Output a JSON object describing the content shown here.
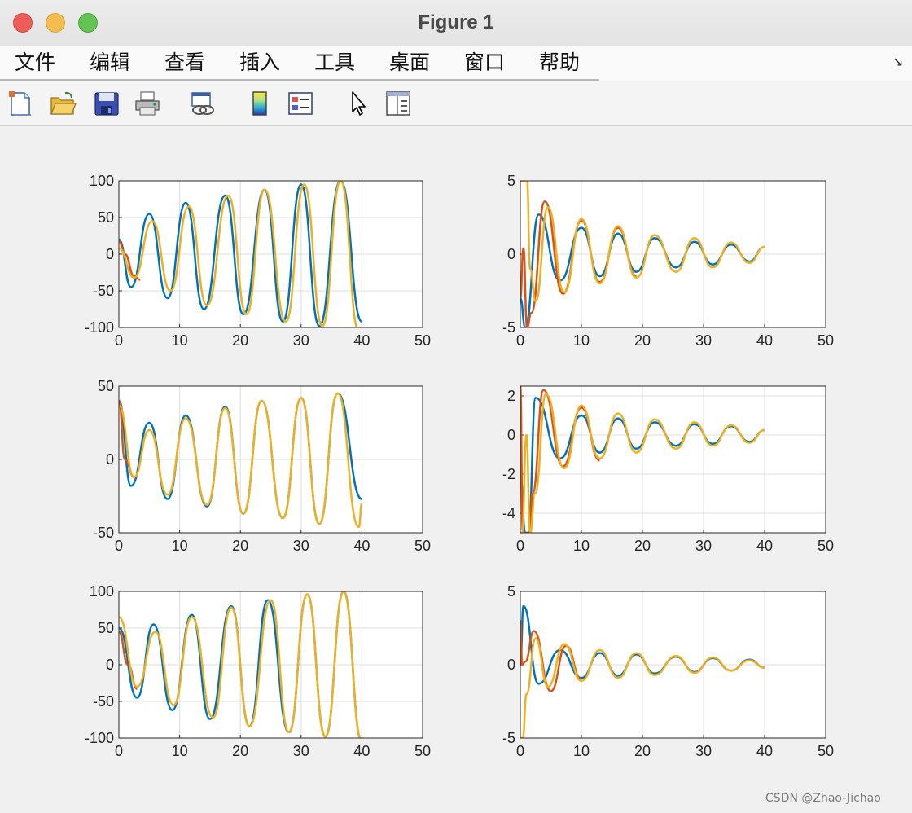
{
  "window": {
    "title": "Figure 1"
  },
  "menu": {
    "items": [
      "文件",
      "编辑",
      "查看",
      "插入",
      "工具",
      "桌面",
      "窗口",
      "帮助"
    ],
    "corner_glyph": "↘"
  },
  "toolbar": {
    "tools": [
      {
        "name": "new-figure-icon"
      },
      {
        "name": "open-file-icon"
      },
      {
        "name": "save-icon"
      },
      {
        "name": "print-icon"
      },
      {
        "name": "link-figure-icon"
      },
      {
        "name": "colorbar-icon"
      },
      {
        "name": "legend-icon"
      },
      {
        "name": "pointer-icon"
      },
      {
        "name": "property-inspector-icon"
      }
    ]
  },
  "colors": {
    "series1": "#0072bd",
    "series2": "#d95319",
    "series3": "#edb120"
  },
  "chart_data": [
    {
      "type": "line",
      "xlim": [
        0,
        50
      ],
      "ylim": [
        -100,
        100
      ],
      "xticks": [
        "0",
        "10",
        "20",
        "30",
        "40",
        "50"
      ],
      "yticks": [
        "100",
        "50",
        "0",
        "-50",
        "-100"
      ],
      "ytick_values": [
        100,
        50,
        0,
        -50,
        -100
      ],
      "grid": true,
      "series": [
        {
          "color": "series1",
          "x": [
            0,
            2,
            5,
            8,
            11,
            14,
            17.5,
            20.5,
            24,
            27,
            30,
            33,
            36.5,
            40
          ],
          "y": [
            20,
            -45,
            55,
            -60,
            70,
            -75,
            80,
            -82,
            88,
            -92,
            95,
            -98,
            100,
            -92
          ]
        },
        {
          "color": "series2",
          "x": [
            0,
            1,
            2.5,
            3.5
          ],
          "y": [
            18,
            0,
            -30,
            -35
          ]
        },
        {
          "color": "series3",
          "x": [
            0,
            2.5,
            5.5,
            8.5,
            11.5,
            14.5,
            18,
            21,
            24,
            27.5,
            30.5,
            33.5,
            36.5,
            39.5
          ],
          "y": [
            8,
            -32,
            45,
            -50,
            65,
            -70,
            80,
            -82,
            88,
            -92,
            95,
            -98,
            100,
            -105
          ]
        }
      ]
    },
    {
      "type": "line",
      "xlim": [
        0,
        50
      ],
      "ylim": [
        -5,
        5
      ],
      "xticks": [
        "0",
        "10",
        "20",
        "30",
        "40",
        "50"
      ],
      "yticks": [
        "5",
        "0",
        "-5"
      ],
      "ytick_values": [
        5,
        0,
        -5
      ],
      "grid": true,
      "series": [
        {
          "color": "series1",
          "x": [
            0,
            0.8,
            3,
            6.5,
            10,
            13,
            16,
            19,
            22,
            25.5,
            28.5,
            31.5,
            34.5,
            37.5,
            40
          ],
          "y": [
            -3,
            -5,
            2.7,
            -1.8,
            1.8,
            -1.5,
            1.4,
            -1.2,
            1.1,
            -0.9,
            0.85,
            -0.7,
            0.65,
            -0.5,
            0.5
          ]
        },
        {
          "color": "series2",
          "x": [
            0,
            0.5,
            1.1,
            1.8,
            4,
            7,
            10,
            13,
            16,
            19
          ],
          "y": [
            -3,
            0.4,
            -5,
            -4,
            3.6,
            -2.7,
            2.3,
            -1.9,
            1.8,
            -1.5
          ]
        },
        {
          "color": "series3",
          "x": [
            0,
            0.5,
            1.1,
            1.6,
            2.5,
            4.5,
            7.2,
            10,
            13,
            16,
            19,
            22,
            25.5,
            28.5,
            31.5,
            34.5,
            37.5,
            40
          ],
          "y": [
            5,
            5,
            5,
            -1,
            -3.2,
            3.2,
            -2.6,
            2.4,
            -2.0,
            1.9,
            -1.6,
            1.3,
            -1.2,
            1.1,
            -0.9,
            0.8,
            -0.6,
            0.5
          ]
        }
      ]
    },
    {
      "type": "line",
      "xlim": [
        0,
        50
      ],
      "ylim": [
        -50,
        50
      ],
      "xticks": [
        "0",
        "10",
        "20",
        "30",
        "40",
        "50"
      ],
      "yticks": [
        "50",
        "0",
        "-50"
      ],
      "ytick_values": [
        50,
        0,
        -50
      ],
      "grid": true,
      "series": [
        {
          "color": "series1",
          "x": [
            0,
            2,
            5,
            8,
            11,
            14.5,
            17.5,
            20.5,
            23.5,
            27,
            30,
            33,
            36,
            40
          ],
          "y": [
            40,
            -18,
            25,
            -27,
            30,
            -32,
            36,
            -37,
            40,
            -40,
            42,
            -44,
            45,
            -27
          ]
        },
        {
          "color": "series2",
          "x": [
            0,
            1,
            2.5
          ],
          "y": [
            40,
            0,
            -12
          ]
        },
        {
          "color": "series3",
          "x": [
            0,
            2.5,
            5,
            8,
            11,
            14.5,
            17.5,
            20.5,
            23.5,
            27,
            30,
            33,
            36,
            39.5,
            40
          ],
          "y": [
            37,
            -12,
            20,
            -24,
            28,
            -31,
            35,
            -37,
            40,
            -40,
            42,
            -44,
            45,
            -46,
            -30
          ]
        }
      ]
    },
    {
      "type": "line",
      "xlim": [
        0,
        50
      ],
      "ylim": [
        -5,
        2.5
      ],
      "xticks": [
        "0",
        "10",
        "20",
        "30",
        "40",
        "50"
      ],
      "yticks": [
        "2",
        "0",
        "-2",
        "-4"
      ],
      "ytick_values": [
        2,
        0,
        -2,
        -4
      ],
      "grid": true,
      "series": [
        {
          "color": "series1",
          "x": [
            0,
            0.8,
            1.3,
            2.5,
            6.5,
            10,
            13,
            16,
            19,
            22,
            25.5,
            28.5,
            31.5,
            34.5,
            37.5,
            40
          ],
          "y": [
            -2,
            -5,
            -5,
            1.9,
            -1.2,
            1.0,
            -0.9,
            0.85,
            -0.7,
            0.65,
            -0.55,
            0.55,
            -0.45,
            0.45,
            -0.35,
            0.25
          ]
        },
        {
          "color": "series2",
          "x": [
            0,
            0.4,
            1.5,
            2,
            3.8,
            7,
            10,
            13
          ],
          "y": [
            2.5,
            -5,
            -5,
            -3,
            2.3,
            -1.6,
            1.4,
            -1.3
          ]
        },
        {
          "color": "series3",
          "x": [
            0,
            0.3,
            1,
            1.6,
            2.4,
            4.2,
            7.2,
            10,
            13,
            16,
            19,
            22,
            25.5,
            28.5,
            31.5,
            34.5,
            37.5,
            40
          ],
          "y": [
            -5,
            -5,
            0,
            -5,
            -3,
            2.1,
            -1.7,
            1.5,
            -1.2,
            1.1,
            -0.9,
            0.8,
            -0.7,
            0.65,
            -0.55,
            0.5,
            -0.4,
            0.25
          ]
        }
      ]
    },
    {
      "type": "line",
      "xlim": [
        0,
        50
      ],
      "ylim": [
        -100,
        100
      ],
      "xticks": [
        "0",
        "10",
        "20",
        "30",
        "40",
        "50"
      ],
      "yticks": [
        "100",
        "50",
        "0",
        "-50",
        "-100"
      ],
      "ytick_values": [
        100,
        50,
        0,
        -50,
        -100
      ],
      "grid": true,
      "series": [
        {
          "color": "series1",
          "x": [
            0,
            3,
            5.7,
            8.8,
            12,
            15,
            18.5,
            21.5,
            24.5,
            28,
            31,
            34,
            37,
            40
          ],
          "y": [
            50,
            -45,
            55,
            -62,
            68,
            -74,
            80,
            -84,
            88,
            -92,
            96,
            -98,
            100,
            -105
          ]
        },
        {
          "color": "series2",
          "x": [
            0,
            1.5,
            3
          ],
          "y": [
            45,
            0,
            -33
          ]
        },
        {
          "color": "series3",
          "x": [
            0,
            3,
            6,
            9,
            12,
            15.5,
            18.5,
            21.5,
            25,
            28,
            31,
            34,
            37,
            40
          ],
          "y": [
            65,
            -30,
            45,
            -55,
            65,
            -72,
            78,
            -84,
            88,
            -92,
            96,
            -98,
            100,
            -105
          ]
        }
      ]
    },
    {
      "type": "line",
      "xlim": [
        0,
        50
      ],
      "ylim": [
        -5,
        5
      ],
      "xticks": [
        "0",
        "10",
        "20",
        "30",
        "40",
        "50"
      ],
      "yticks": [
        "5",
        "0",
        "-5"
      ],
      "ytick_values": [
        5,
        0,
        -5
      ],
      "grid": true,
      "series": [
        {
          "color": "series1",
          "x": [
            0,
            0.5,
            3,
            6.5,
            10,
            13,
            16,
            19,
            22,
            25.5,
            28.5,
            31.5,
            34.5,
            37.5,
            40
          ],
          "y": [
            0,
            4,
            -1.3,
            1.0,
            -0.9,
            0.8,
            -0.75,
            0.7,
            -0.6,
            0.55,
            -0.5,
            0.45,
            -0.4,
            0.35,
            -0.2
          ]
        },
        {
          "color": "series2",
          "x": [
            0,
            0.3,
            0.8,
            2.2,
            5,
            7.5,
            10
          ],
          "y": [
            3,
            0,
            0.2,
            2.3,
            -1.8,
            1.3,
            -1.0
          ]
        },
        {
          "color": "series3",
          "x": [
            0,
            0.4,
            1,
            2.5,
            4.5,
            7.2,
            10,
            13,
            16,
            19,
            22,
            25.5,
            28.5,
            31.5,
            34.5,
            37.5,
            40
          ],
          "y": [
            -5,
            -5,
            -2,
            1.8,
            -1.5,
            1.4,
            -1.1,
            1.0,
            -0.9,
            0.8,
            -0.7,
            0.6,
            -0.55,
            0.5,
            -0.4,
            0.3,
            -0.2
          ]
        }
      ]
    }
  ],
  "watermark": "CSDN @Zhao-Jichao"
}
